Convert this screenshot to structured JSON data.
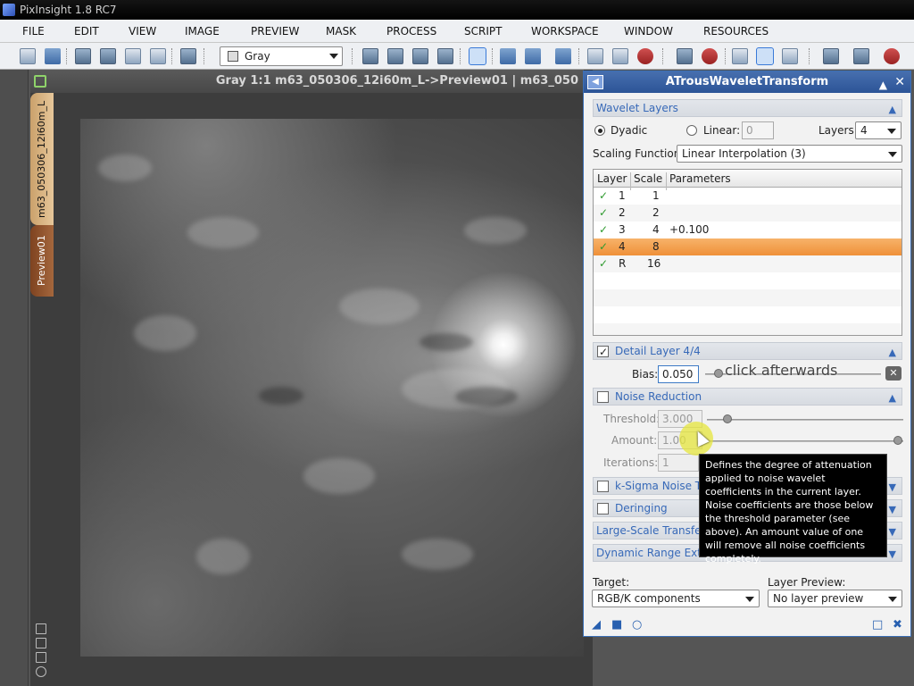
{
  "app": {
    "title": "PixInsight 1.8 RC7"
  },
  "menu": [
    "FILE",
    "EDIT",
    "VIEW",
    "IMAGE",
    "PREVIEW",
    "MASK",
    "PROCESS",
    "SCRIPT",
    "WORKSPACE",
    "WINDOW",
    "RESOURCES"
  ],
  "toolbar": {
    "view_selector": "Gray"
  },
  "image_window": {
    "title": "Gray 1:1 m63_050306_12i60m_L->Preview01 | m63_050",
    "tabs": [
      "m63_050306_12i60m_L",
      "Preview01"
    ]
  },
  "dialog": {
    "title": "ATrousWaveletTransform",
    "wavelet_layers": {
      "header": "Wavelet Layers",
      "dyadic_label": "Dyadic",
      "linear_label": "Linear:",
      "linear_value": "0",
      "layers_label": "Layers:",
      "layers_value": "4",
      "scaling_label": "Scaling Function:",
      "scaling_value": "Linear Interpolation (3)",
      "columns": [
        "Layer",
        "Scale",
        "Parameters"
      ],
      "rows": [
        {
          "layer": "1",
          "scale": "1",
          "params": ""
        },
        {
          "layer": "2",
          "scale": "2",
          "params": ""
        },
        {
          "layer": "3",
          "scale": "4",
          "params": "+0.100"
        },
        {
          "layer": "4",
          "scale": "8",
          "params": ""
        },
        {
          "layer": "R",
          "scale": "16",
          "params": ""
        }
      ]
    },
    "detail_layer": {
      "header": "Detail Layer 4/4",
      "bias_label": "Bias:",
      "bias_value": "0.050"
    },
    "annotation": "click afterwards",
    "noise_reduction": {
      "header": "Noise Reduction",
      "threshold_label": "Threshold:",
      "threshold_value": "3.000",
      "amount_label": "Amount:",
      "amount_value": "1.00",
      "iterations_label": "Iterations:",
      "iterations_value": "1"
    },
    "sections": {
      "ksigma": "k-Sigma Noise Th",
      "deringing": "Deringing",
      "large_scale": "Large-Scale Transfer F",
      "dynamic_range": "Dynamic Range Exten"
    },
    "tooltip": "Defines the degree of attenuation applied to noise wavelet coefficients in the current layer. Noise coefficients are those below the threshold parameter (see above). An amount value of one will remove all noise coefficients completely.",
    "target": {
      "label": "Target:",
      "value": "RGB/K components"
    },
    "layer_preview": {
      "label": "Layer Preview:",
      "value": "No layer preview"
    }
  }
}
